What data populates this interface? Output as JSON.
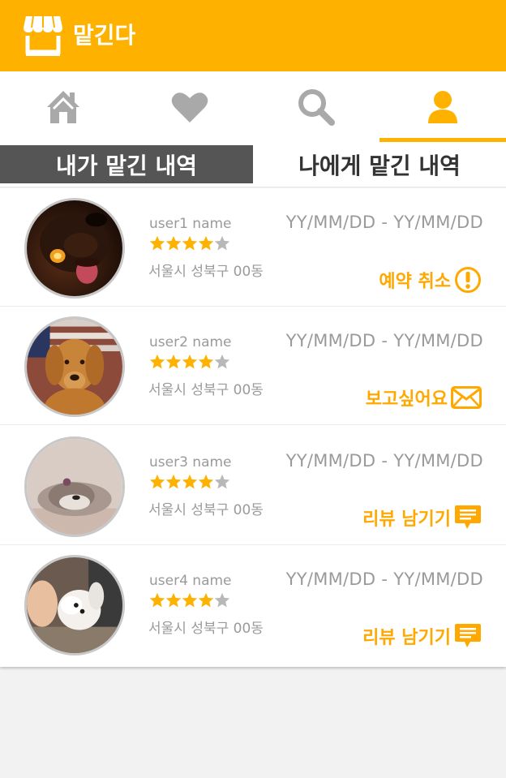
{
  "app": {
    "title": "맡긴다",
    "accent": "#ffb100"
  },
  "nav": [
    {
      "name": "home-icon"
    },
    {
      "name": "heart-icon"
    },
    {
      "name": "search-icon"
    },
    {
      "name": "user-icon",
      "active": true
    }
  ],
  "tabs": {
    "mine": "내가 맡긴 내역",
    "others": "나에게 맡긴 내역"
  },
  "items": [
    {
      "user": "user1 name",
      "rating": 4,
      "address": "서울시 성북구 00동",
      "dates": "YY/MM/DD - YY/MM/DD",
      "action": "예약 취소",
      "action_icon": "alert-circle-icon"
    },
    {
      "user": "user2 name",
      "rating": 4,
      "address": "서울시 성북구 00동",
      "dates": "YY/MM/DD - YY/MM/DD",
      "action": "보고싶어요",
      "action_icon": "mail-icon"
    },
    {
      "user": "user3 name",
      "rating": 4,
      "address": "서울시 성북구 00동",
      "dates": "YY/MM/DD - YY/MM/DD",
      "action": "리뷰 남기기",
      "action_icon": "comment-icon"
    },
    {
      "user": "user4 name",
      "rating": 4,
      "address": "서울시 성북구 00동",
      "dates": "YY/MM/DD - YY/MM/DD",
      "action": "리뷰 남기기",
      "action_icon": "comment-icon"
    }
  ]
}
